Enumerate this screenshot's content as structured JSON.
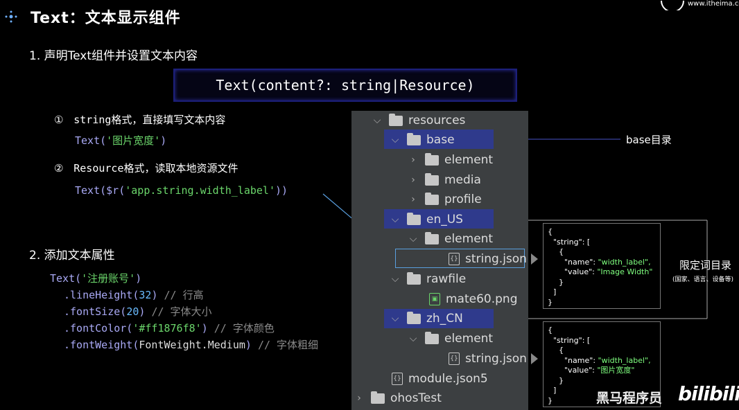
{
  "header": {
    "title": "Text：文本显示组件",
    "site": "www.itheima.com"
  },
  "section1": {
    "heading": "1. 声明Text组件并设置文本内容",
    "signature": "Text(content?: string|Resource)",
    "item1_marker": "①",
    "item1_label": "string格式，直接填写文本内容",
    "item1_code_fn": "Text(",
    "item1_code_str": "'图片宽度'",
    "item1_code_end": ")",
    "item2_marker": "②",
    "item2_label": "Resource格式，读取本地资源文件",
    "item2_code_fn": "Text($r(",
    "item2_code_str": "'app.string.width_label'",
    "item2_code_end": "))"
  },
  "section2": {
    "heading": "2. 添加文本属性",
    "line1_fn": "Text(",
    "line1_str": "'注册账号'",
    "line1_end": ")",
    "line2_fn": ".lineHeight(",
    "line2_num": "32",
    "line2_end": ")",
    "line2_cm": "// 行高",
    "line3_fn": ".fontSize(",
    "line3_num": "20",
    "line3_end": ")",
    "line3_cm": "// 字体大小",
    "line4_fn": ".fontColor(",
    "line4_str": "'#ff1876f8'",
    "line4_end": ")",
    "line4_cm": "// 字体颜色",
    "line5_fn": ".fontWeight(",
    "line5_arg": "FontWeight.Medium",
    "line5_end": ")",
    "line5_cm": "// 字体粗细"
  },
  "tree": {
    "items": [
      {
        "label": "resources",
        "type": "folder",
        "expanded": true
      },
      {
        "label": "base",
        "type": "folder",
        "expanded": true,
        "highlight": true
      },
      {
        "label": "element",
        "type": "folder",
        "expanded": false
      },
      {
        "label": "media",
        "type": "folder",
        "expanded": false
      },
      {
        "label": "profile",
        "type": "folder",
        "expanded": false
      },
      {
        "label": "en_US",
        "type": "folder",
        "expanded": true,
        "highlight": true
      },
      {
        "label": "element",
        "type": "folder",
        "expanded": true
      },
      {
        "label": "string.json",
        "type": "file",
        "selected": true
      },
      {
        "label": "rawfile",
        "type": "folder",
        "expanded": true
      },
      {
        "label": "mate60.png",
        "type": "image"
      },
      {
        "label": "zh_CN",
        "type": "folder",
        "expanded": true,
        "highlight": true
      },
      {
        "label": "element",
        "type": "folder",
        "expanded": true
      },
      {
        "label": "string.json",
        "type": "file"
      },
      {
        "label": "module.json5",
        "type": "file"
      },
      {
        "label": "ohosTest",
        "type": "folder",
        "expanded": false
      }
    ]
  },
  "annotations": {
    "base_label": "base目录",
    "qualifier_label": "限定词目录",
    "qualifier_sub": "(国家、语言、设备等)"
  },
  "json_en": {
    "l1": "{",
    "l2": "\"string\": [",
    "l3": "{",
    "l4_k": "\"name\": ",
    "l4_v": "\"width_label\",",
    "l5_k": "\"value\": ",
    "l5_v": "\"Image Width\"",
    "l6": "}",
    "l7": "]",
    "l8": "}"
  },
  "json_zh": {
    "l1": "{",
    "l2": "\"string\": [",
    "l3": "{",
    "l4_k": "\"name\": ",
    "l4_v": "\"width_label\",",
    "l5_k": "\"value\": ",
    "l5_v": "\"图片宽度\"",
    "l6": "}",
    "l7": "]",
    "l8": "}"
  },
  "watermark": {
    "brand": "黑马程序员",
    "platform": "bilibili"
  },
  "colors": {
    "accent_blue": "#2f3a8c",
    "code_fn": "#a9a9f5",
    "code_str": "#6bd66b",
    "code_num": "#6bbcff",
    "json_value": "#7fff7f"
  }
}
